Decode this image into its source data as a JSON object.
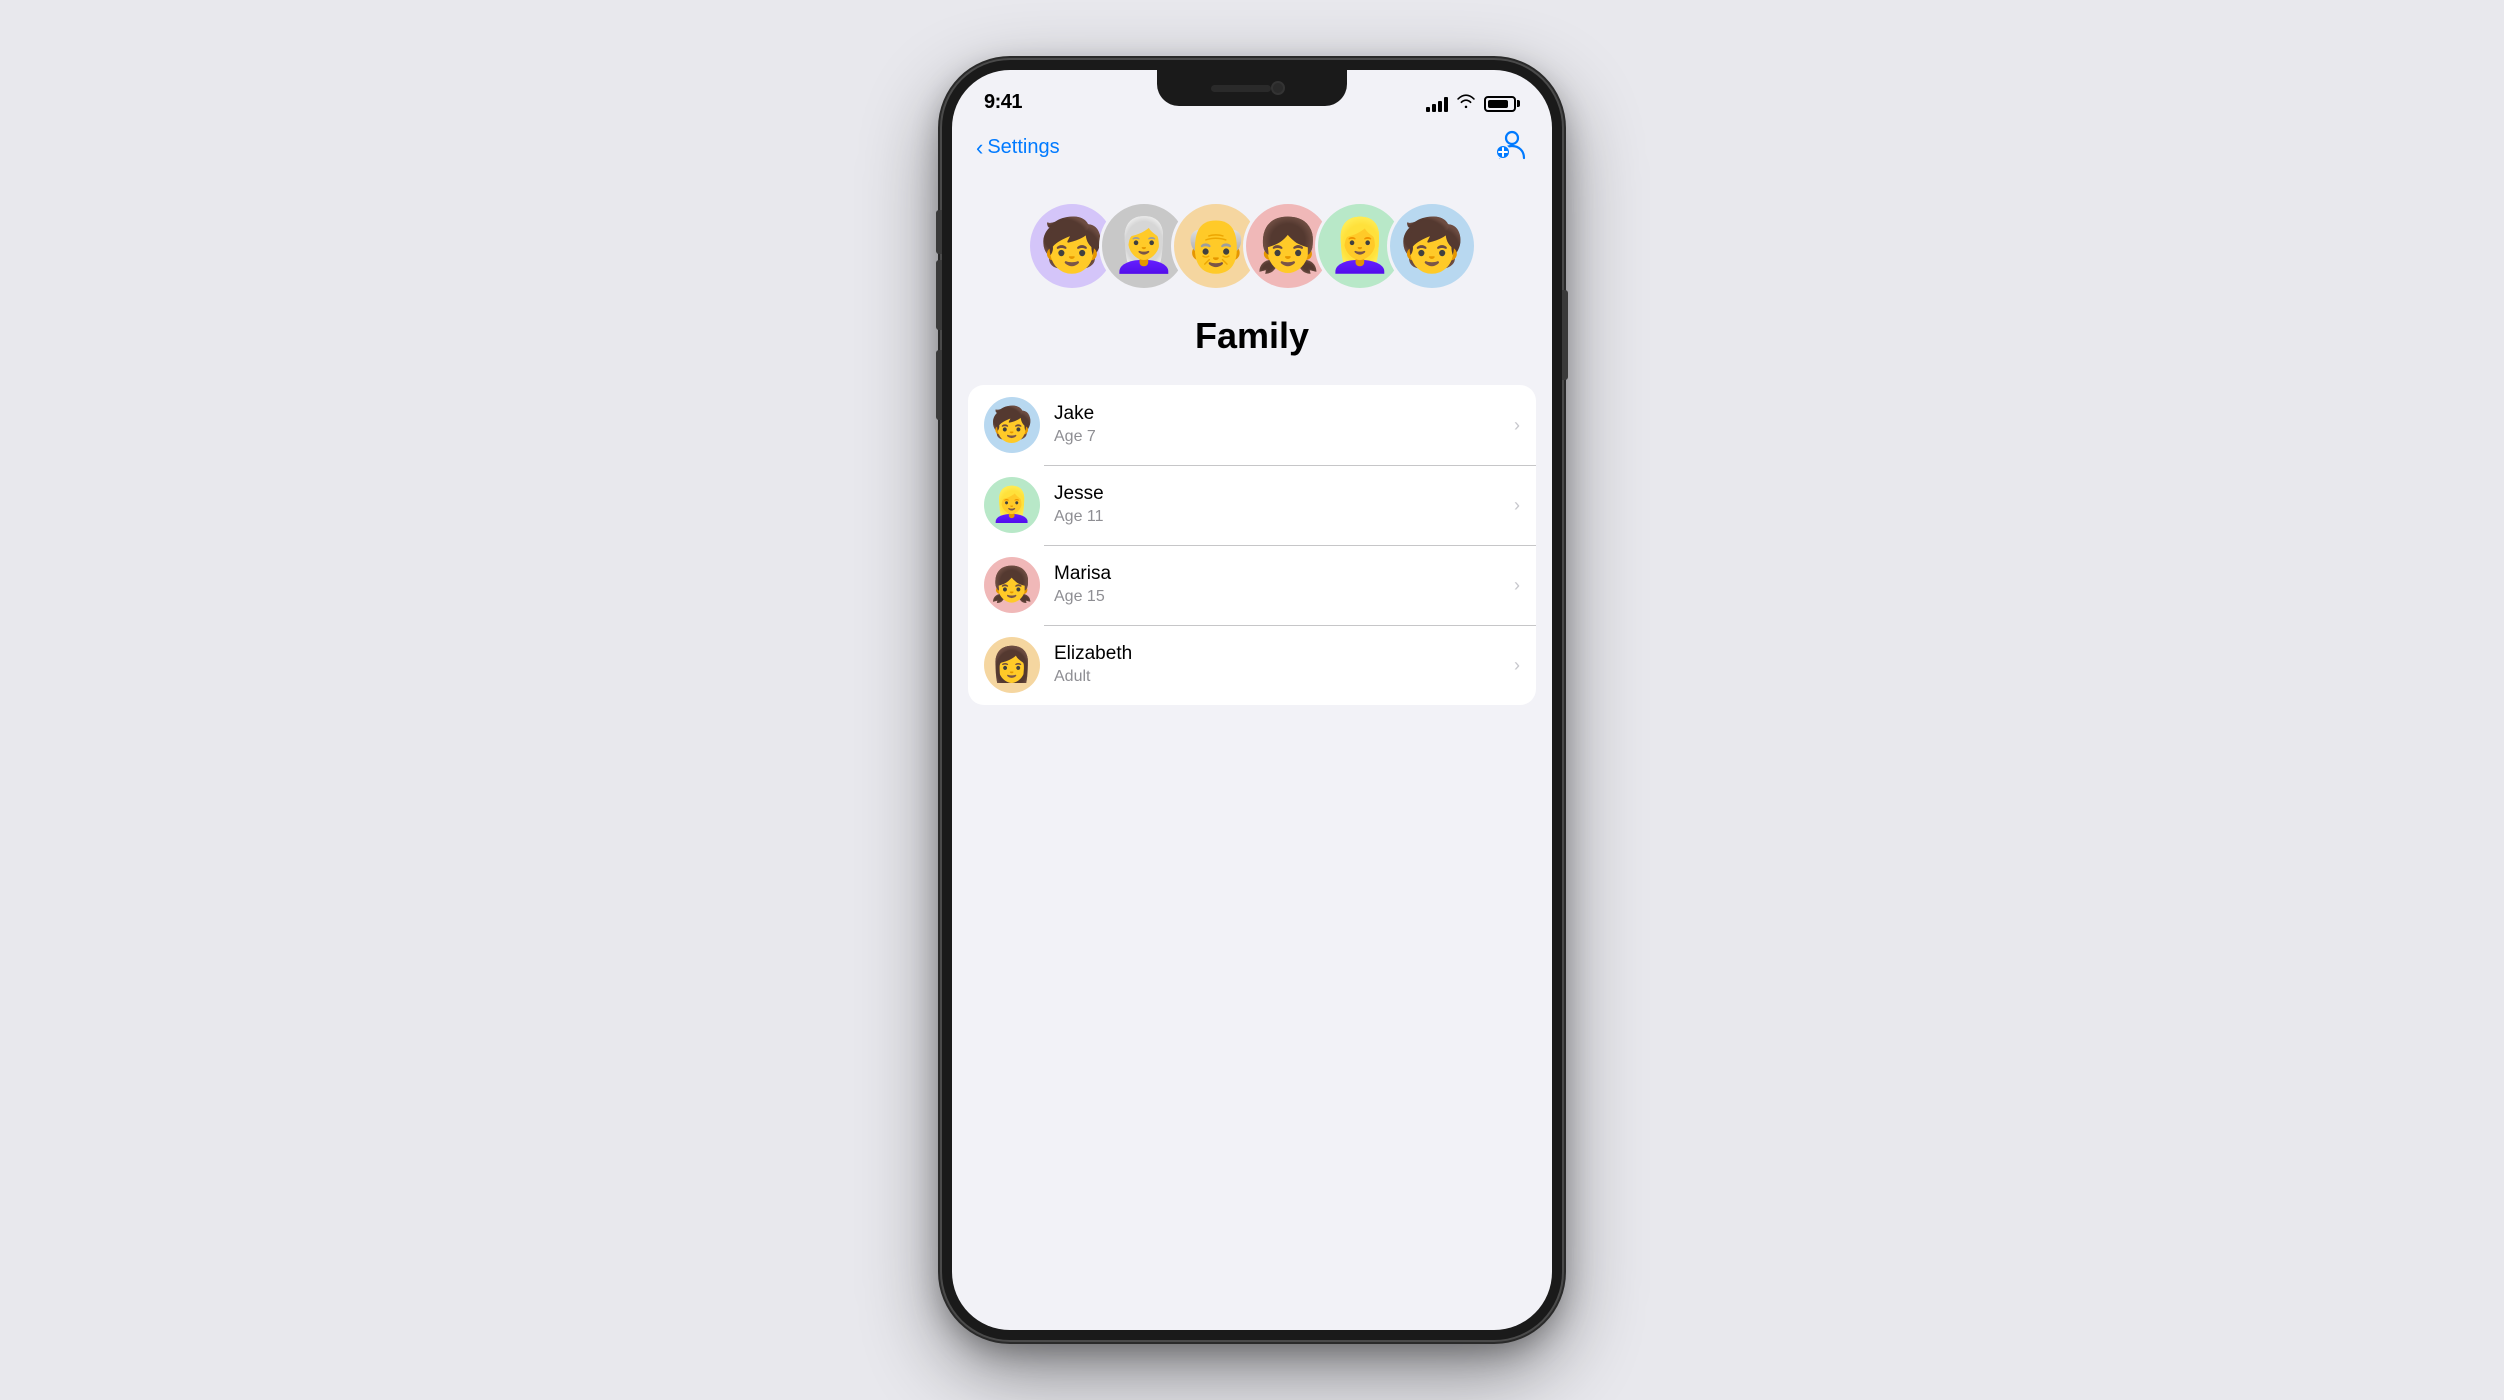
{
  "status_bar": {
    "time": "9:41",
    "signal_bars": [
      6,
      9,
      12,
      15
    ],
    "battery_level": 85
  },
  "nav": {
    "back_label": "Settings",
    "add_member_label": "Add Member"
  },
  "header": {
    "title": "Family"
  },
  "avatars": [
    {
      "bg": "avatar-bg-purple",
      "emoji": "🧒"
    },
    {
      "bg": "avatar-bg-gray",
      "emoji": "👩"
    },
    {
      "bg": "avatar-bg-orange",
      "emoji": "👴"
    },
    {
      "bg": "avatar-bg-pink",
      "emoji": "👧"
    },
    {
      "bg": "avatar-bg-green",
      "emoji": "👩"
    },
    {
      "bg": "avatar-bg-blue",
      "emoji": "🧒"
    }
  ],
  "members": [
    {
      "name": "Jake",
      "sub": "Age 7",
      "avatar_bg": "#b8d8f0",
      "emoji": "🧒"
    },
    {
      "name": "Jesse",
      "sub": "Age 11",
      "avatar_bg": "#b8e8c8",
      "emoji": "👧"
    },
    {
      "name": "Marisa",
      "sub": "Age 15",
      "avatar_bg": "#f0b8b8",
      "emoji": "👧"
    },
    {
      "name": "Elizabeth",
      "sub": "Adult",
      "avatar_bg": "#f5d6a0",
      "emoji": "👩"
    }
  ]
}
